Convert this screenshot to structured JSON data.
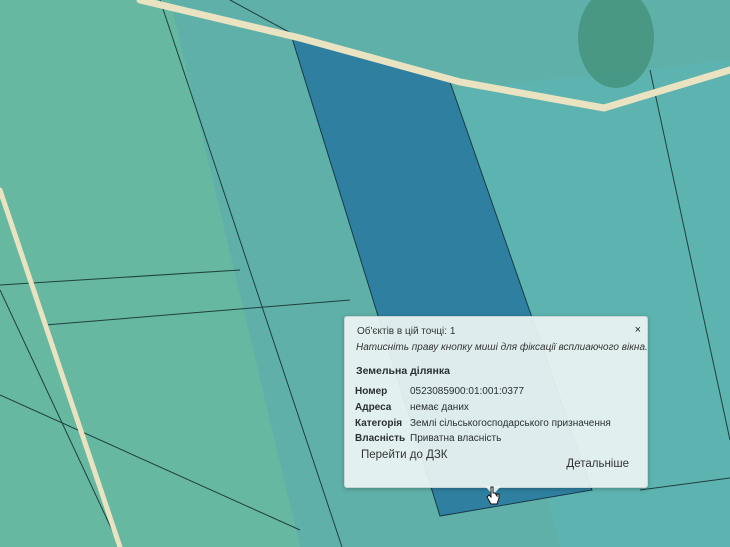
{
  "popup": {
    "count_text": "Об'єктів в цій точці: 1",
    "hint_text": "Натисніть праву кнопку миші для фіксації всплиаючого вікна.",
    "close_label": "×",
    "section_title": "Земельна ділянка",
    "fields": [
      {
        "label": "Номер",
        "value": "0523085900:01:001:0377"
      },
      {
        "label": "Адреса",
        "value": "немає даних"
      },
      {
        "label": "Категорія",
        "value": "Землі сільськогосподарського призначення"
      },
      {
        "label": "Власність",
        "value": "Приватна власність"
      }
    ],
    "link_dzk": "Перейти до ДЗК",
    "link_details": "Детальніше"
  },
  "colors": {
    "background": "#5fb0a8",
    "selected_parcel": "#2f7fa0",
    "road": "#eae3c1",
    "parcel_lines": "#1f3f3f"
  }
}
